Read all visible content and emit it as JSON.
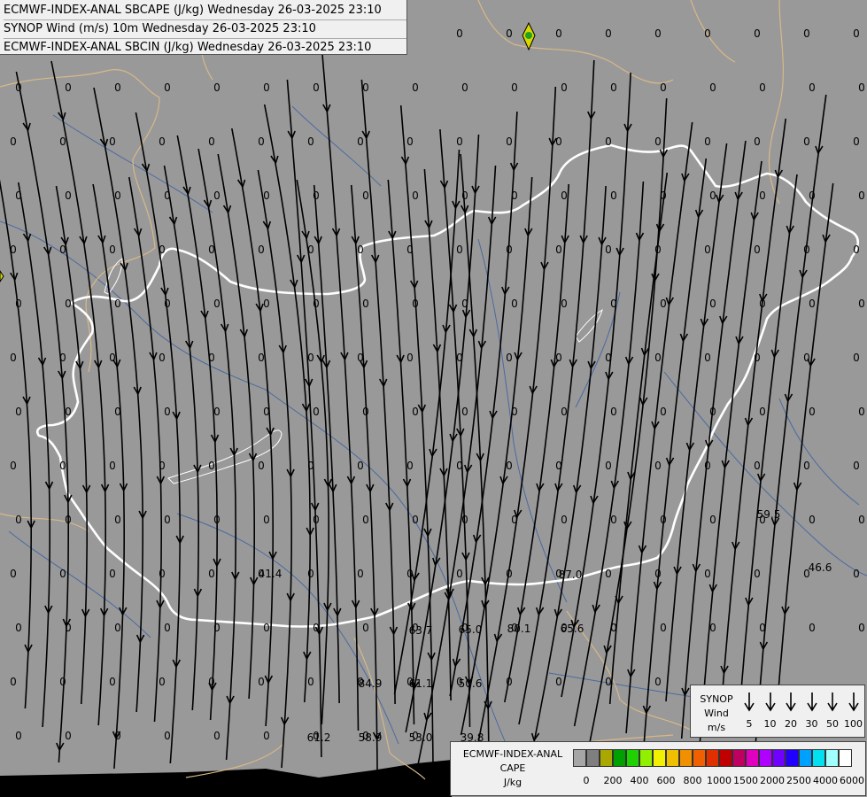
{
  "header": {
    "line1": "ECMWF-INDEX-ANAL SBCAPE (J/kg) Wednesday 26-03-2025 23:10",
    "line2": "SYNOP Wind (m/s) 10m Wednesday 26-03-2025 23:10",
    "line3": "ECMWF-INDEX-ANAL SBCIN (J/kg) Wednesday 26-03-2025 23:10"
  },
  "synop_legend": {
    "title_line1": "SYNOP",
    "title_line2": "Wind",
    "title_line3": "m/s",
    "values": [
      "5",
      "10",
      "20",
      "30",
      "50",
      "100"
    ]
  },
  "cape_legend": {
    "title_line1": "ECMWF-INDEX-ANAL",
    "title_line2": "CAPE",
    "title_line3": "J/kg",
    "colors": [
      "#a6a6a6",
      "#7f7f7f",
      "#a8a800",
      "#00a000",
      "#20d000",
      "#90f000",
      "#f0f000",
      "#f0c000",
      "#f09000",
      "#f06000",
      "#e03000",
      "#c00000",
      "#c00060",
      "#e000c0",
      "#b000ff",
      "#7000ff",
      "#2000ff",
      "#00a0ff",
      "#00e0f0",
      "#a0ffff",
      "#ffffff"
    ],
    "ticks": [
      "0",
      "200",
      "400",
      "600",
      "800",
      "1000",
      "1500",
      "2000",
      "2500",
      "4000",
      "6000"
    ]
  },
  "map_values": [
    {
      "text": "0"
    },
    {
      "text": "59.5"
    },
    {
      "text": "46.6"
    },
    {
      "text": "41.4"
    },
    {
      "text": "87.0"
    },
    {
      "text": "63.7"
    },
    {
      "text": "65.0"
    },
    {
      "text": "80.1"
    },
    {
      "text": "65.6"
    },
    {
      "text": "84.9"
    },
    {
      "text": "61.1"
    },
    {
      "text": "50.6"
    },
    {
      "text": "61.2"
    },
    {
      "text": "58.9"
    },
    {
      "text": "53.0"
    },
    {
      "text": "39.8"
    }
  ],
  "colors": {
    "background": "#999999",
    "border": "#ffffff",
    "neighbor_border": "#d8b888",
    "river": "#4a6aa0",
    "streamline": "#000000",
    "station_marker": "#20a020"
  }
}
